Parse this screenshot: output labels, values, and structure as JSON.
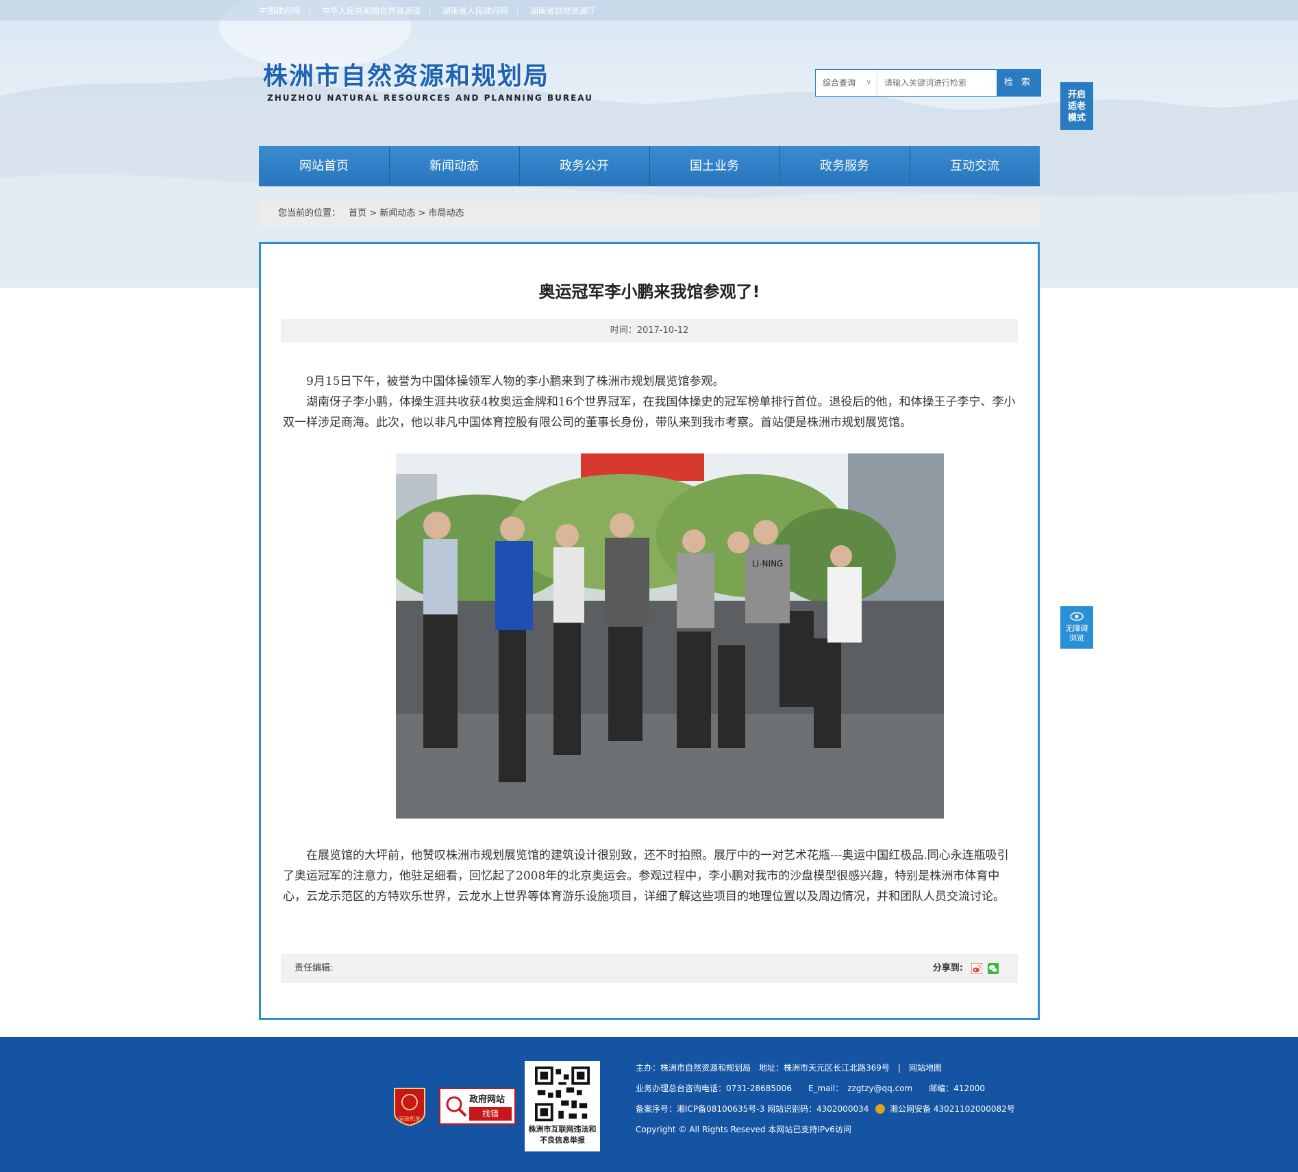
{
  "top_links": [
    "中国政府网",
    "中华人民共和国自然资源部",
    "湖南省人民政府网",
    "湖南省自然资源厅"
  ],
  "logo": {
    "cn": "株洲市自然资源和规划局",
    "en": "ZHUZHOU NATURAL RESOURCES AND PLANNING BUREAU"
  },
  "search": {
    "category": "综合查询",
    "placeholder": "请输入关键词进行检索",
    "button": "检 索"
  },
  "elder_mode": {
    "label": "开启适老模式"
  },
  "nav": [
    "网站首页",
    "新闻动态",
    "政务公开",
    "国土业务",
    "政务服务",
    "互动交流"
  ],
  "breadcrumb": {
    "prefix": "您当前的位置：",
    "path": "首页 > 新闻动态 > 市局动态"
  },
  "article": {
    "title": "奥运冠军李小鹏来我馆参观了!",
    "time": "时间：2017-10-12",
    "p1": "　　9月15日下午，被誉为中国体操领军人物的李小鹏来到了株洲市规划展览馆参观。",
    "p2": "　　湖南伢子李小鹏，体操生涯共收获4枚奥运金牌和16个世界冠军，在我国体操史的冠军榜单排行首位。退役后的他，和体操王子李宁、李小双一样涉足商海。此次，他以非凡中国体育控股有限公司的董事长身份，带队来到我市考察。首站便是株洲市规划展览馆。",
    "p3": "　　在展览馆的大坪前，他赞叹株洲市规划展览馆的建筑设计很别致，还不时拍照。展厅中的一对艺术花瓶---奥运中国红极品.同心永连瓶吸引了奥运冠军的注意力，他驻足细看，回忆起了2008年的北京奥运会。参观过程中，李小鹏对我市的沙盘模型很感兴趣，特别是株洲市体育中心，云龙示范区的方特欢乐世界，云龙水上世界等体育游乐设施项目，详细了解这些项目的地理位置以及周边情况，并和团队人员交流讨论。",
    "editor": "责任编辑:",
    "share": "分享到:"
  },
  "photo": {
    "shirt_text": "LI-NING"
  },
  "accessibility": {
    "label1": "无障碍",
    "label2": "浏览"
  },
  "footer": {
    "badge1": "党政机关",
    "badge2_top": "政府网站",
    "badge2_bottom": "找错",
    "qr_caption": "株洲市互联网违法和不良信息举报",
    "line1": "主办：株洲市自然资源和规划局　地址：株洲市天元区长江北路369号　|　网站地图",
    "line2": "业务办理总台咨询电话：0731-28685006　　E_mail：　zzgtzy@qq.com　　邮编：412000",
    "line3": "备案序号：湘ICP备08100635号-3  网站识别码：4302000034",
    "line3b": "湘公网安备 43021102000082号",
    "line4": "Copyright © All Rights Reseved 本网站已支持IPv6访问"
  },
  "colors": {
    "brand_blue": "#2b7bc2",
    "footer_blue": "#1553a3",
    "panel_border": "#2b8fd6"
  }
}
